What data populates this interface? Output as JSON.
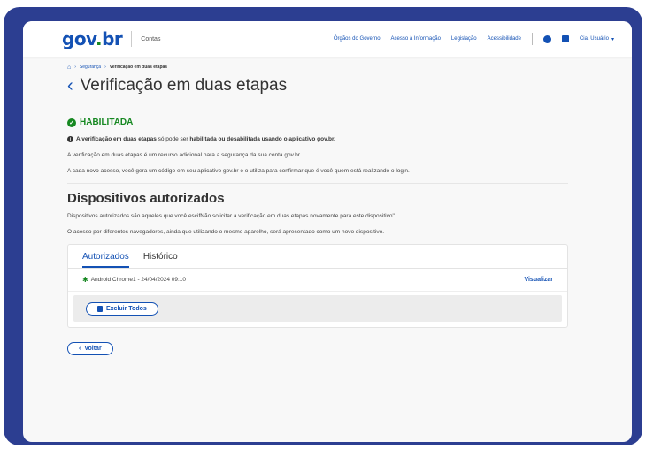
{
  "header": {
    "logo_gov": "gov",
    "logo_dot": ".",
    "logo_br": "br",
    "app_name": "Contas",
    "nav": [
      "Órgãos do Governo",
      "Acesso à Informação",
      "Legislação",
      "Acessibilidade"
    ],
    "user_label": "Cia. Usuário"
  },
  "breadcrumb": {
    "items": [
      "Segurança",
      "Verificação em duas etapas"
    ]
  },
  "page": {
    "title": "Verificação em duas etapas",
    "status": "HABILITADA",
    "info_bold_1": "A verificação em duas etapas",
    "info_text_1": " só pode ser ",
    "info_bold_2": "habilitada ou desabilitada usando o aplicativo gov.br.",
    "para1": "A verificação em duas etapas é um recurso adicional para a segurança da sua conta gov.br.",
    "para2": "A cada novo acesso, você gera um código em seu aplicativo gov.br e o utiliza para confirmar que é você quem está realizando o login."
  },
  "devices": {
    "title": "Dispositivos autorizados",
    "para1": "Dispositivos autorizados são aqueles que você escifNão solicitar a verificação em duas etapas novamente para este dispositivo\"",
    "para2": "O acesso por diferentes navegadores, ainda que utilizando o mesmo aparelho, será apresentado como um novo dispositivo.",
    "tabs": [
      "Autorizados",
      "Histórico"
    ],
    "rows": [
      {
        "label": "Android Chrome1 - 24/04/2024 09:10",
        "action": "Visualizar"
      }
    ],
    "delete_all": "Excluir Todos"
  },
  "back_button": "Voltar",
  "colors": {
    "primary": "#1351b4",
    "success": "#168821",
    "frame": "#2c3e91"
  }
}
